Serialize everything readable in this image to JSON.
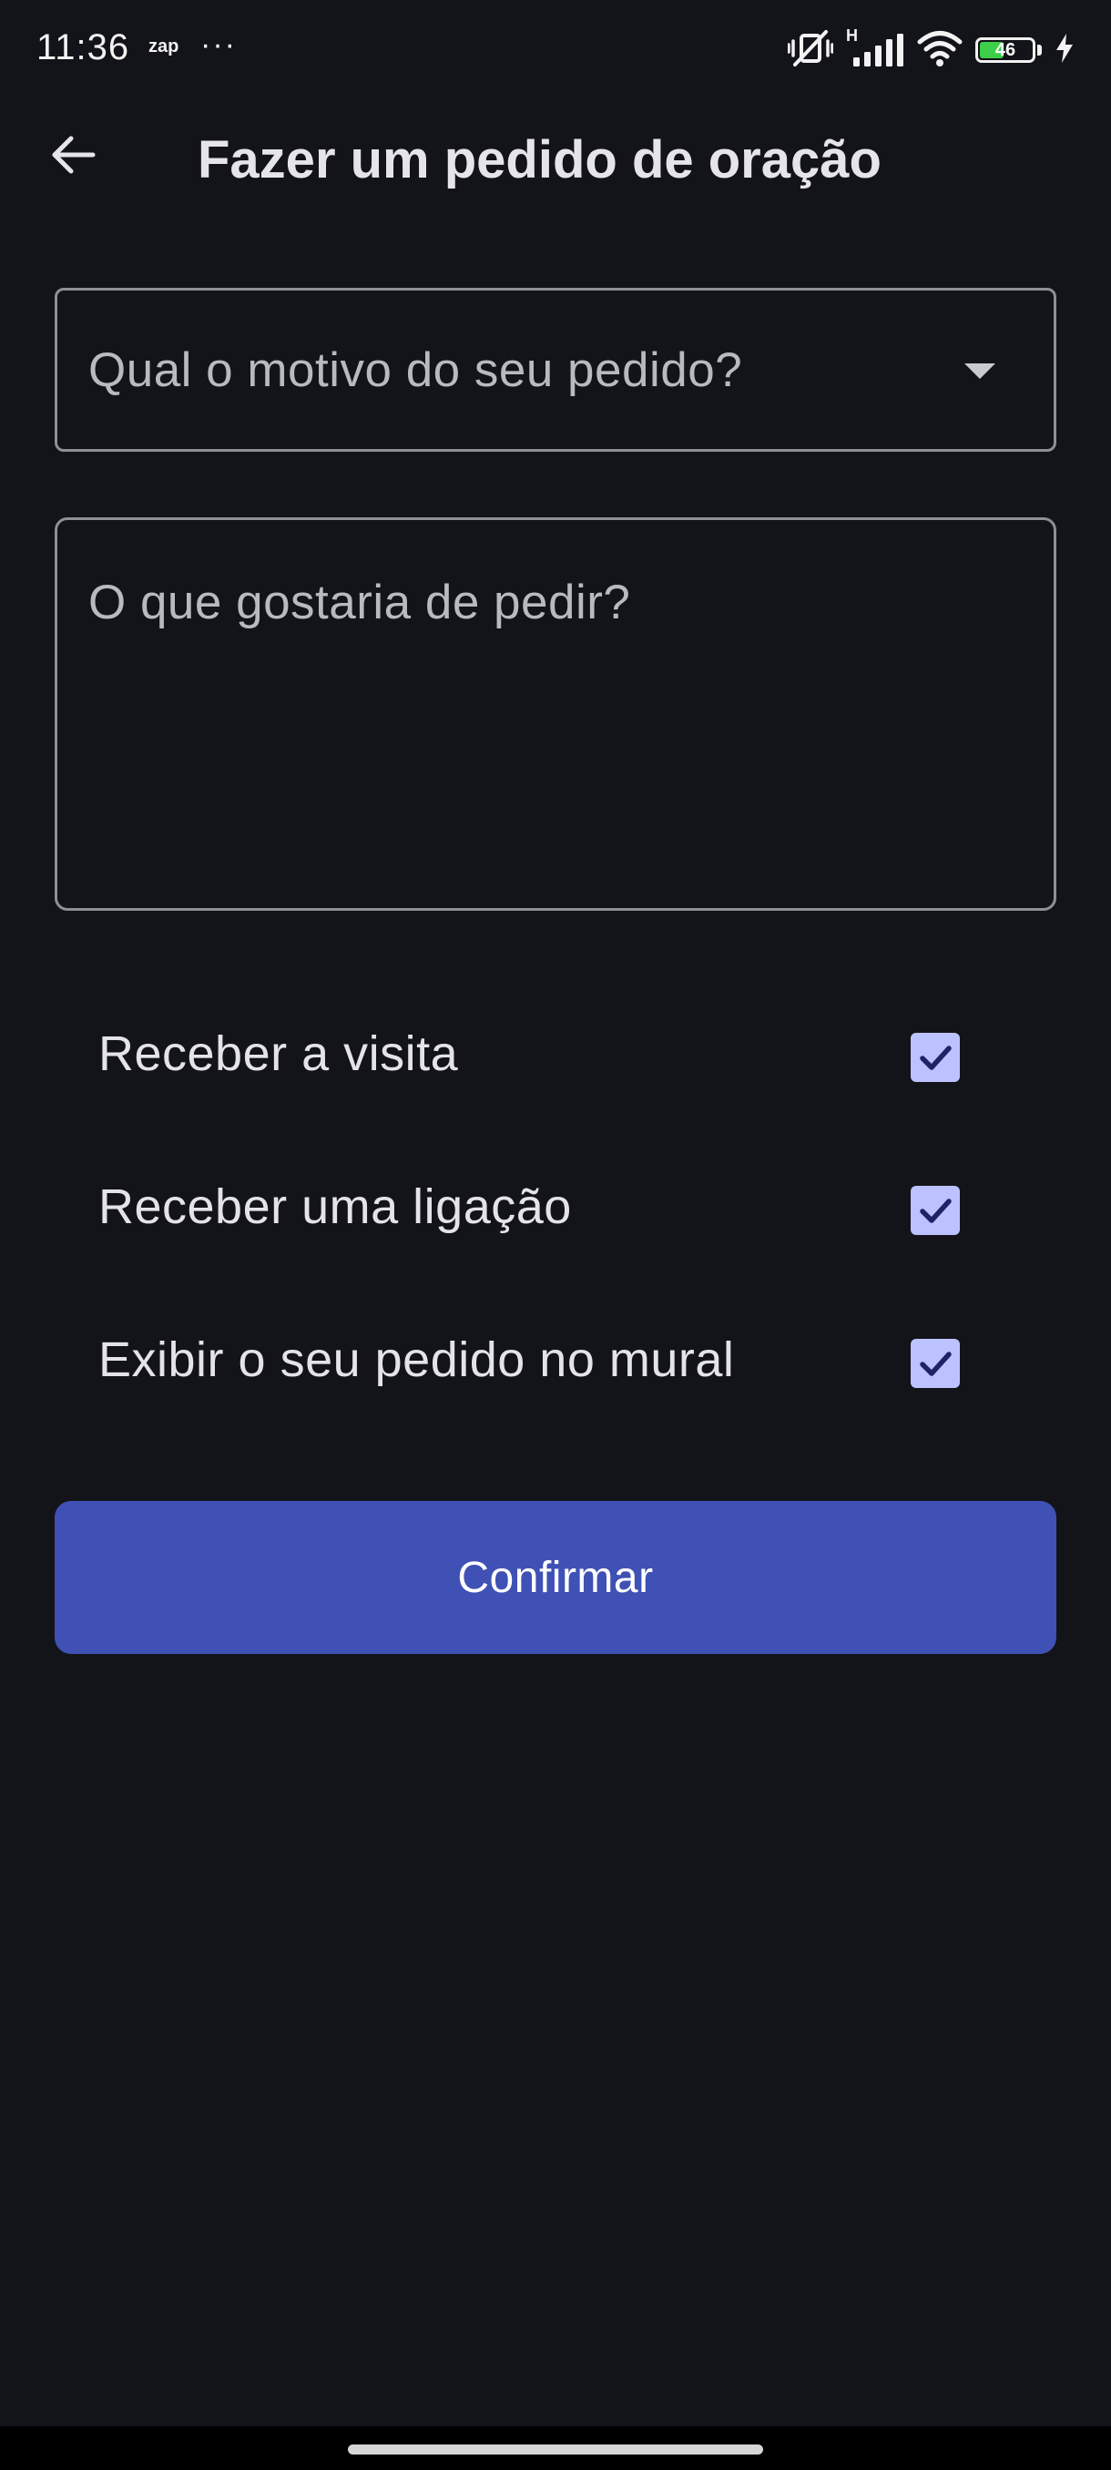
{
  "status_bar": {
    "time": "11:36",
    "app_label": "zap",
    "more_indicator": "···",
    "icons": [
      "vibrate-off-icon",
      "signal-icon",
      "wifi-icon",
      "battery-icon",
      "charging-icon"
    ],
    "signal_type": "H",
    "battery_level": "46",
    "battery_fraction": 0.46
  },
  "app_bar": {
    "back_icon": "arrow-left-icon",
    "title": "Fazer um pedido de oração"
  },
  "form": {
    "reason_dropdown": {
      "placeholder": "Qual o motivo do seu pedido?",
      "icon": "caret-down-icon"
    },
    "request_text": {
      "placeholder": "O que gostaria de pedir?"
    },
    "options": [
      {
        "label": "Receber a visita",
        "checked": true
      },
      {
        "label": "Receber uma ligação",
        "checked": true
      },
      {
        "label": "Exibir o seu pedido no mural",
        "checked": true
      }
    ],
    "confirm_label": "Confirmar"
  },
  "colors": {
    "background": "#131419",
    "primary_button": "#3f51b5",
    "checkbox_fill": "#bcc2ff",
    "checkmark": "#1d2366",
    "outline": "#8e8f97"
  }
}
